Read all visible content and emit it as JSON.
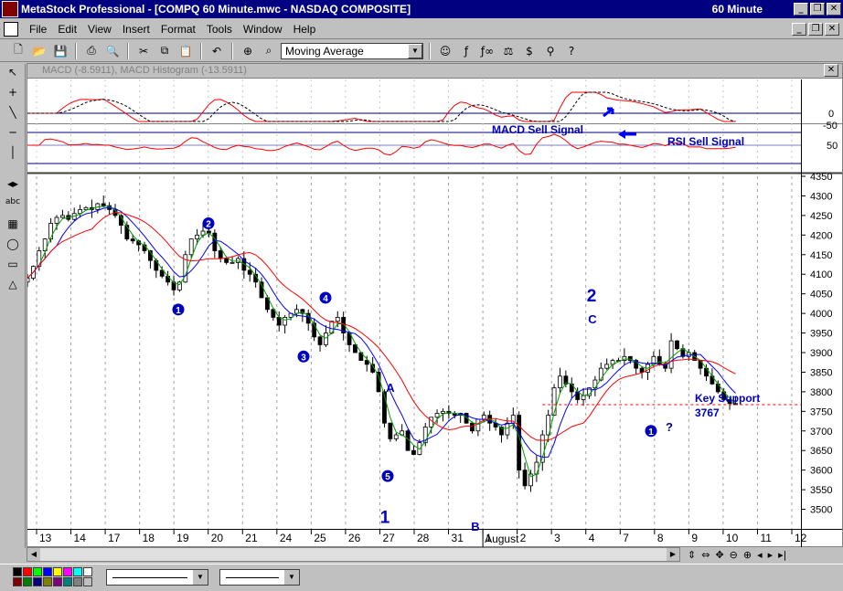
{
  "app": {
    "title": "MetaStock Professional - [COMPQ 60 Minute.mwc - NASDAQ  COMPOSITE]",
    "interval": "60 Minute"
  },
  "menu": [
    "File",
    "Edit",
    "View",
    "Insert",
    "Format",
    "Tools",
    "Window",
    "Help"
  ],
  "toolbar": {
    "indicator_select": "Moving Average"
  },
  "window_title": "MACD (-8.5911), MACD Histogram (-13.5911)",
  "macd_pane": {
    "ticks": [
      "0",
      "-50"
    ],
    "annotation": "MACD Sell Signal",
    "colors": {
      "macd": "#ff0000",
      "signal": "#000000",
      "zero": "#000080"
    }
  },
  "rsi_pane": {
    "ticks": [
      "50"
    ],
    "annotation": "RSI Sell Signal",
    "colors": {
      "rsi": "#ff0000",
      "band": "#000080"
    }
  },
  "chart_data": {
    "type": "candlestick",
    "title": "",
    "ylim": [
      3450,
      4350
    ],
    "y_ticks": [
      4350,
      4300,
      4250,
      4200,
      4150,
      4100,
      4050,
      4000,
      3950,
      3900,
      3850,
      3800,
      3750,
      3700,
      3650,
      3600,
      3550,
      3500
    ],
    "x_date_labels": [
      "13",
      "14",
      "17",
      "18",
      "19",
      "20",
      "21",
      "24",
      "25",
      "26",
      "27",
      "28",
      "31",
      "1",
      "2",
      "3",
      "4",
      "7",
      "8",
      "9",
      "10",
      "11",
      "12"
    ],
    "month_label": "August",
    "key_support_value": 3767,
    "key_support_label": "Key Support",
    "key_support_price": "3767",
    "wave_labels": [
      {
        "text": "1",
        "style": "circled",
        "value": 4010
      },
      {
        "text": "2",
        "style": "circled",
        "value": 4230
      },
      {
        "text": "3",
        "style": "circled",
        "value": 3890
      },
      {
        "text": "4",
        "style": "circled",
        "value": 4040
      },
      {
        "text": "5",
        "style": "circled",
        "value": 3585
      },
      {
        "text": "1",
        "style": "large",
        "value": 3465
      },
      {
        "text": "A",
        "style": "letter",
        "value": 3800
      },
      {
        "text": "B",
        "style": "letter",
        "value": 3445
      },
      {
        "text": "C",
        "style": "letter",
        "value": 3975
      },
      {
        "text": "2",
        "style": "large",
        "value": 4030
      },
      {
        "text": "1",
        "style": "circled",
        "value": 3700
      },
      {
        "text": "?",
        "style": "plain",
        "value": 3700
      }
    ],
    "series": [
      {
        "name": "",
        "color": "#ff0000",
        "role": "long moving average"
      },
      {
        "name": "",
        "color": "#0000ff",
        "role": "medium moving average"
      },
      {
        "name": "",
        "color": "#00a000",
        "role": "short moving average"
      }
    ],
    "close": [
      4090,
      4120,
      4160,
      4190,
      4230,
      4245,
      4250,
      4240,
      4255,
      4265,
      4270,
      4265,
      4280,
      4275,
      4265,
      4250,
      4225,
      4190,
      4185,
      4175,
      4160,
      4135,
      4110,
      4095,
      4080,
      4060,
      4080,
      4150,
      4190,
      4200,
      4210,
      4205,
      4160,
      4140,
      4130,
      4130,
      4140,
      4110,
      4100,
      4080,
      4040,
      4010,
      3990,
      3970,
      3990,
      4000,
      4010,
      4000,
      3975,
      3940,
      3920,
      3950,
      3980,
      3990,
      3950,
      3920,
      3900,
      3880,
      3870,
      3850,
      3800,
      3720,
      3680,
      3690,
      3700,
      3650,
      3640,
      3670,
      3710,
      3735,
      3745,
      3750,
      3745,
      3740,
      3745,
      3720,
      3700,
      3730,
      3740,
      3720,
      3710,
      3690,
      3720,
      3740,
      3600,
      3560,
      3590,
      3620,
      3690,
      3740,
      3810,
      3840,
      3820,
      3800,
      3780,
      3790,
      3810,
      3830,
      3860,
      3870,
      3880,
      3880,
      3890,
      3880,
      3860,
      3850,
      3870,
      3890,
      3870,
      3860,
      3930,
      3910,
      3890,
      3900,
      3880,
      3860,
      3840,
      3820,
      3800,
      3780,
      3770,
      3767
    ],
    "volatility": 22
  },
  "bottom": {
    "palette": [
      "#000000",
      "#ff0000",
      "#00ff00",
      "#0000ff",
      "#ffff00",
      "#ff00ff",
      "#00ffff",
      "#ffffff",
      "#800000",
      "#008000",
      "#000080",
      "#808000",
      "#800080",
      "#008080",
      "#808080",
      "#c0c0c0"
    ]
  }
}
